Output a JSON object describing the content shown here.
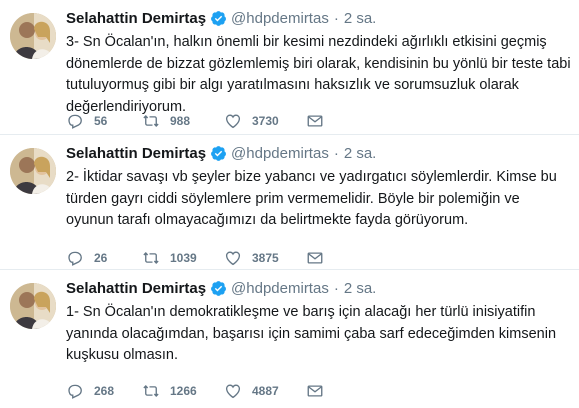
{
  "tweets": [
    {
      "name": "Selahattin Demirtaş",
      "handle": "@hdpdemirtas",
      "time": "2 sa.",
      "text": "3- Sn Öcalan'ın, halkın önemli bir kesimi nezdindeki ağırlıklı etkisini geçmiş dönemlerde de bizzat gözlemlemiş biri olarak, kendisinin bu yönlü bir teste tabi tutuluyormuş gibi bir algı yaratılmasını haksızlık ve sorumsuzluk olarak değerlendiriyorum.",
      "replies": "56",
      "retweets": "988",
      "likes": "3730"
    },
    {
      "name": "Selahattin Demirtaş",
      "handle": "@hdpdemirtas",
      "time": "2 sa.",
      "text": "2- İktidar savaşı vb şeyler bize yabancı ve yadırgatıcı söylemlerdir. Kimse bu türden gayrı ciddi söylemlere prim vermemelidir. Böyle bir polemiğin ve oyunun tarafı olmayacağımızı da belirtmekte fayda görüyorum.",
      "replies": "26",
      "retweets": "1039",
      "likes": "3875"
    },
    {
      "name": "Selahattin Demirtaş",
      "handle": "@hdpdemirtas",
      "time": "2 sa.",
      "text": "1- Sn Öcalan'ın demokratikleşme ve barış için alacağı her türlü inisiyatifin yanında olacağımdan, başarısı için samimi çaba sarf edeceğimden kimsenin kuşkusu olmasın.",
      "replies": "268",
      "retweets": "1266",
      "likes": "4887"
    }
  ],
  "separator": "·",
  "colors": {
    "text": "#14171a",
    "muted": "#657786",
    "verified": "#1da1f2",
    "divider": "#e6ecf0"
  },
  "icons": {
    "avatar": "profile-photo",
    "verified": "verified-badge-icon",
    "reply": "reply-icon",
    "retweet": "retweet-icon",
    "like": "heart-icon",
    "message": "envelope-icon"
  }
}
